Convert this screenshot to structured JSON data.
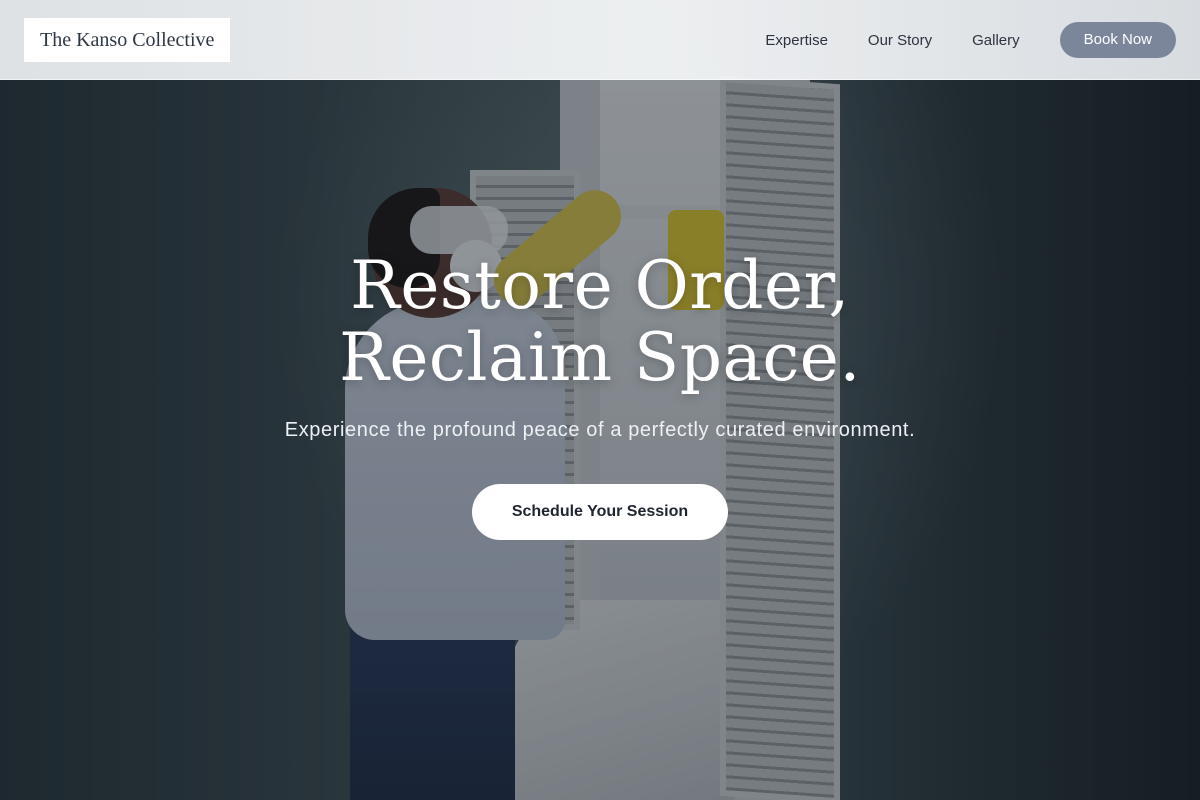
{
  "header": {
    "logo_text": "The Kanso Collective",
    "nav": [
      {
        "label": "Expertise"
      },
      {
        "label": "Our Story"
      },
      {
        "label": "Gallery"
      }
    ],
    "book_label": "Book Now"
  },
  "hero": {
    "title_line1": "Restore Order,",
    "title_line2": "Reclaim Space.",
    "subtitle": "Experience the profound peace of a perfectly curated environment.",
    "cta_label": "Schedule Your Session"
  },
  "colors": {
    "book_button_bg": "#7b869b",
    "cta_bg": "#ffffff",
    "header_bg": "#eef0f2",
    "hero_text": "#ffffff"
  }
}
